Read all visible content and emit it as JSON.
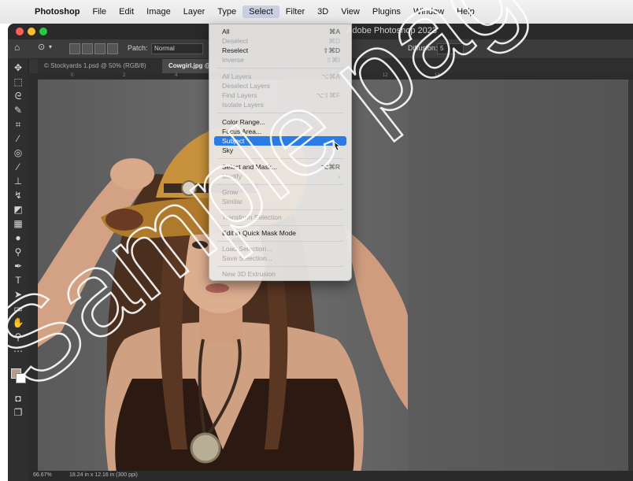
{
  "menubar": {
    "items": [
      "Photoshop",
      "File",
      "Edit",
      "Image",
      "Layer",
      "Type",
      "Select",
      "Filter",
      "3D",
      "View",
      "Plugins",
      "Window",
      "Help"
    ],
    "active_index": 6
  },
  "window": {
    "title": "Adobe Photoshop 2023"
  },
  "options_bar": {
    "patch_label": "Patch:",
    "patch_value": "Normal",
    "diffusion_label": "Diffusion:",
    "diffusion_value": "5"
  },
  "tabs": [
    {
      "label": "© Stockyards 1.psd @ 50% (RGB/8)"
    },
    {
      "label": "Cowgirl.jpg @"
    }
  ],
  "ruler": {
    "ticks": [
      "0",
      "2",
      "4",
      "6",
      "8",
      "10",
      "12",
      "14"
    ]
  },
  "status": {
    "zoom": "66.67%",
    "doc_info": "18.24 in x 12.16 in (300 ppi)"
  },
  "select_menu": {
    "items": [
      {
        "label": "All",
        "shortcut": "⌘A",
        "disabled": false
      },
      {
        "label": "Deselect",
        "shortcut": "⌘D",
        "disabled": true
      },
      {
        "label": "Reselect",
        "shortcut": "⇧⌘D",
        "disabled": false
      },
      {
        "label": "Inverse",
        "shortcut": "⇧⌘I",
        "disabled": true
      },
      {
        "label": "All Layers",
        "shortcut": "⌥⌘A",
        "disabled": true
      },
      {
        "label": "Deselect Layers",
        "shortcut": "",
        "disabled": true
      },
      {
        "label": "Find Layers",
        "shortcut": "⌥⇧⌘F",
        "disabled": true
      },
      {
        "label": "Isolate Layers",
        "shortcut": "",
        "disabled": true
      },
      {
        "label": "Color Range...",
        "shortcut": "",
        "disabled": false
      },
      {
        "label": "Focus Area...",
        "shortcut": "",
        "disabled": false
      },
      {
        "label": "Subject",
        "shortcut": "",
        "disabled": false,
        "highlighted": true
      },
      {
        "label": "Sky",
        "shortcut": "",
        "disabled": false
      },
      {
        "label": "Select and Mask...",
        "shortcut": "⌥⌘R",
        "disabled": false
      },
      {
        "label": "Modify",
        "shortcut": "›",
        "disabled": true
      },
      {
        "label": "Grow",
        "shortcut": "",
        "disabled": true
      },
      {
        "label": "Similar",
        "shortcut": "",
        "disabled": true
      },
      {
        "label": "Transform Selection",
        "shortcut": "",
        "disabled": true
      },
      {
        "label": "Edit in Quick Mask Mode",
        "shortcut": "",
        "disabled": false
      },
      {
        "label": "Load Selection...",
        "shortcut": "",
        "disabled": true
      },
      {
        "label": "Save Selection...",
        "shortcut": "",
        "disabled": true
      },
      {
        "label": "New 3D Extrusion",
        "shortcut": "",
        "disabled": true
      }
    ]
  },
  "watermark": {
    "text": "Sample pages"
  },
  "colors": {
    "highlight": "#2b7be4",
    "ps_dark": "#353535",
    "menu_bg": "#ecebe9"
  }
}
